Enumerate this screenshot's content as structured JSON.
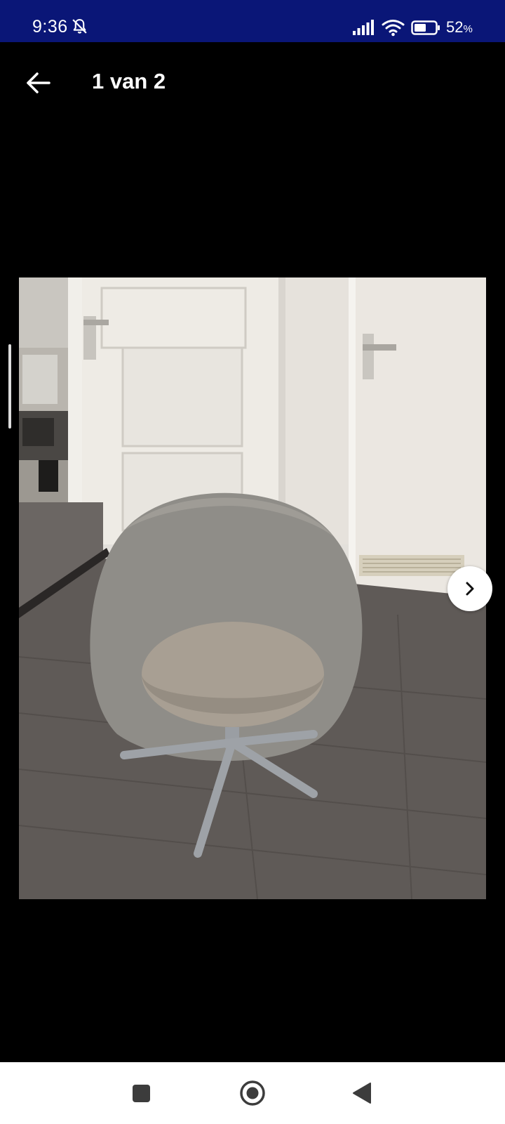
{
  "status_bar": {
    "time": "9:36",
    "battery_percent": "52",
    "battery_unit": "%",
    "background": "#0a1677",
    "icons": [
      "bell-off-icon",
      "signal-icon",
      "wifi-icon",
      "battery-icon"
    ]
  },
  "header": {
    "back_icon": "arrow-left-icon",
    "title": "1 van 2"
  },
  "gallery": {
    "image_subject": "grey upholstered swivel chair on wooden floor",
    "next_icon": "chevron-right-icon"
  },
  "nav_bar": {
    "icons": [
      "recent-apps-icon",
      "home-icon",
      "back-triangle-icon"
    ]
  }
}
